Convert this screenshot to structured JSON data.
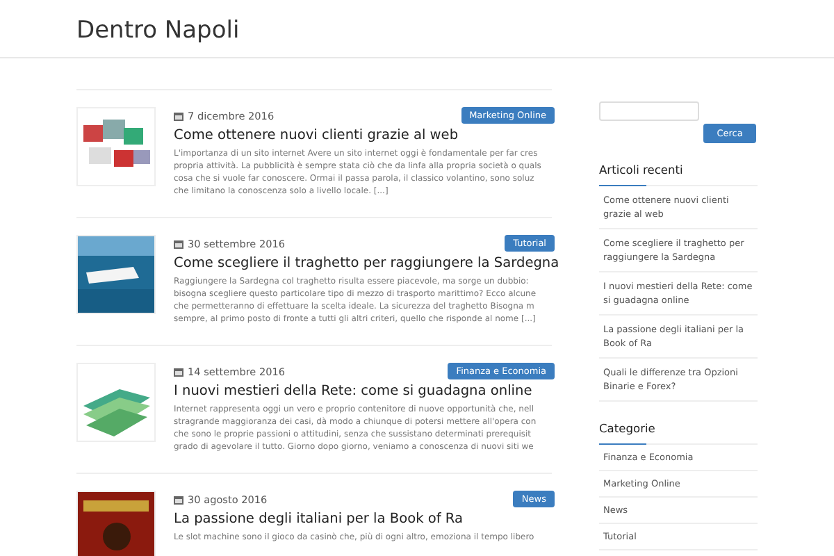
{
  "site_title": "Dentro Napoli",
  "posts": [
    {
      "date": "7 dicembre 2016",
      "category": "Marketing Online",
      "title": "Come ottenere nuovi clienti grazie al web",
      "excerpt": [
        "L'importanza di un sito internet Avere un sito internet oggi è fondamentale per far cres",
        "propria attività. La pubblicità è sempre stata ciò che da linfa alla propria società o quals",
        "cosa che si vuole far conoscere. Ormai il passa parola, il classico volantino, sono soluz",
        "che limitano la conoscenza solo a livello locale. [...]"
      ]
    },
    {
      "date": "30 settembre 2016",
      "category": "Tutorial",
      "title": "Come scegliere il traghetto per raggiungere la Sardegna",
      "excerpt": [
        "Raggiungere la Sardegna col traghetto risulta essere piacevole, ma sorge un dubbio:",
        "bisogna scegliere questo particolare tipo di mezzo di trasporto marittimo? Ecco alcune",
        "che permetteranno di effettuare la scelta ideale. La sicurezza del traghetto Bisogna m",
        "sempre, al primo posto di fronte a tutti gli altri criteri, quello che risponde al nome [...]"
      ]
    },
    {
      "date": "14 settembre 2016",
      "category": "Finanza e Economia",
      "title": "I nuovi mestieri della Rete: come si guadagna online",
      "excerpt": [
        "Internet rappresenta oggi un vero e proprio contenitore di nuove opportunità che, nell",
        "stragrande maggioranza dei casi, dà modo a chiunque di potersi mettere all'opera con",
        "che sono le proprie passioni o attitudini, senza che sussistano determinati prerequisit",
        "grado di agevolare il tutto. Giorno dopo giorno, veniamo a conoscenza di nuovi siti we"
      ]
    },
    {
      "date": "30 agosto 2016",
      "category": "News",
      "title": "La passione degli italiani per la Book of Ra",
      "excerpt": [
        "Le slot machine sono il gioco da casinò che, più di ogni altro, emoziona il tempo libero"
      ]
    }
  ],
  "search": {
    "button": "Cerca"
  },
  "recent": {
    "heading": "Articoli recenti",
    "items": [
      "Come ottenere nuovi clienti grazie al web",
      "Come scegliere il traghetto per raggiungere la Sardegna",
      "I nuovi mestieri della Rete: come si guadagna online",
      "La passione degli italiani per la Book of Ra",
      "Quali le differenze tra Opzioni Binarie e Forex?"
    ]
  },
  "categories": {
    "heading": "Categorie",
    "items": [
      "Finanza e Economia",
      "Marketing Online",
      "News",
      "Tutorial"
    ]
  }
}
